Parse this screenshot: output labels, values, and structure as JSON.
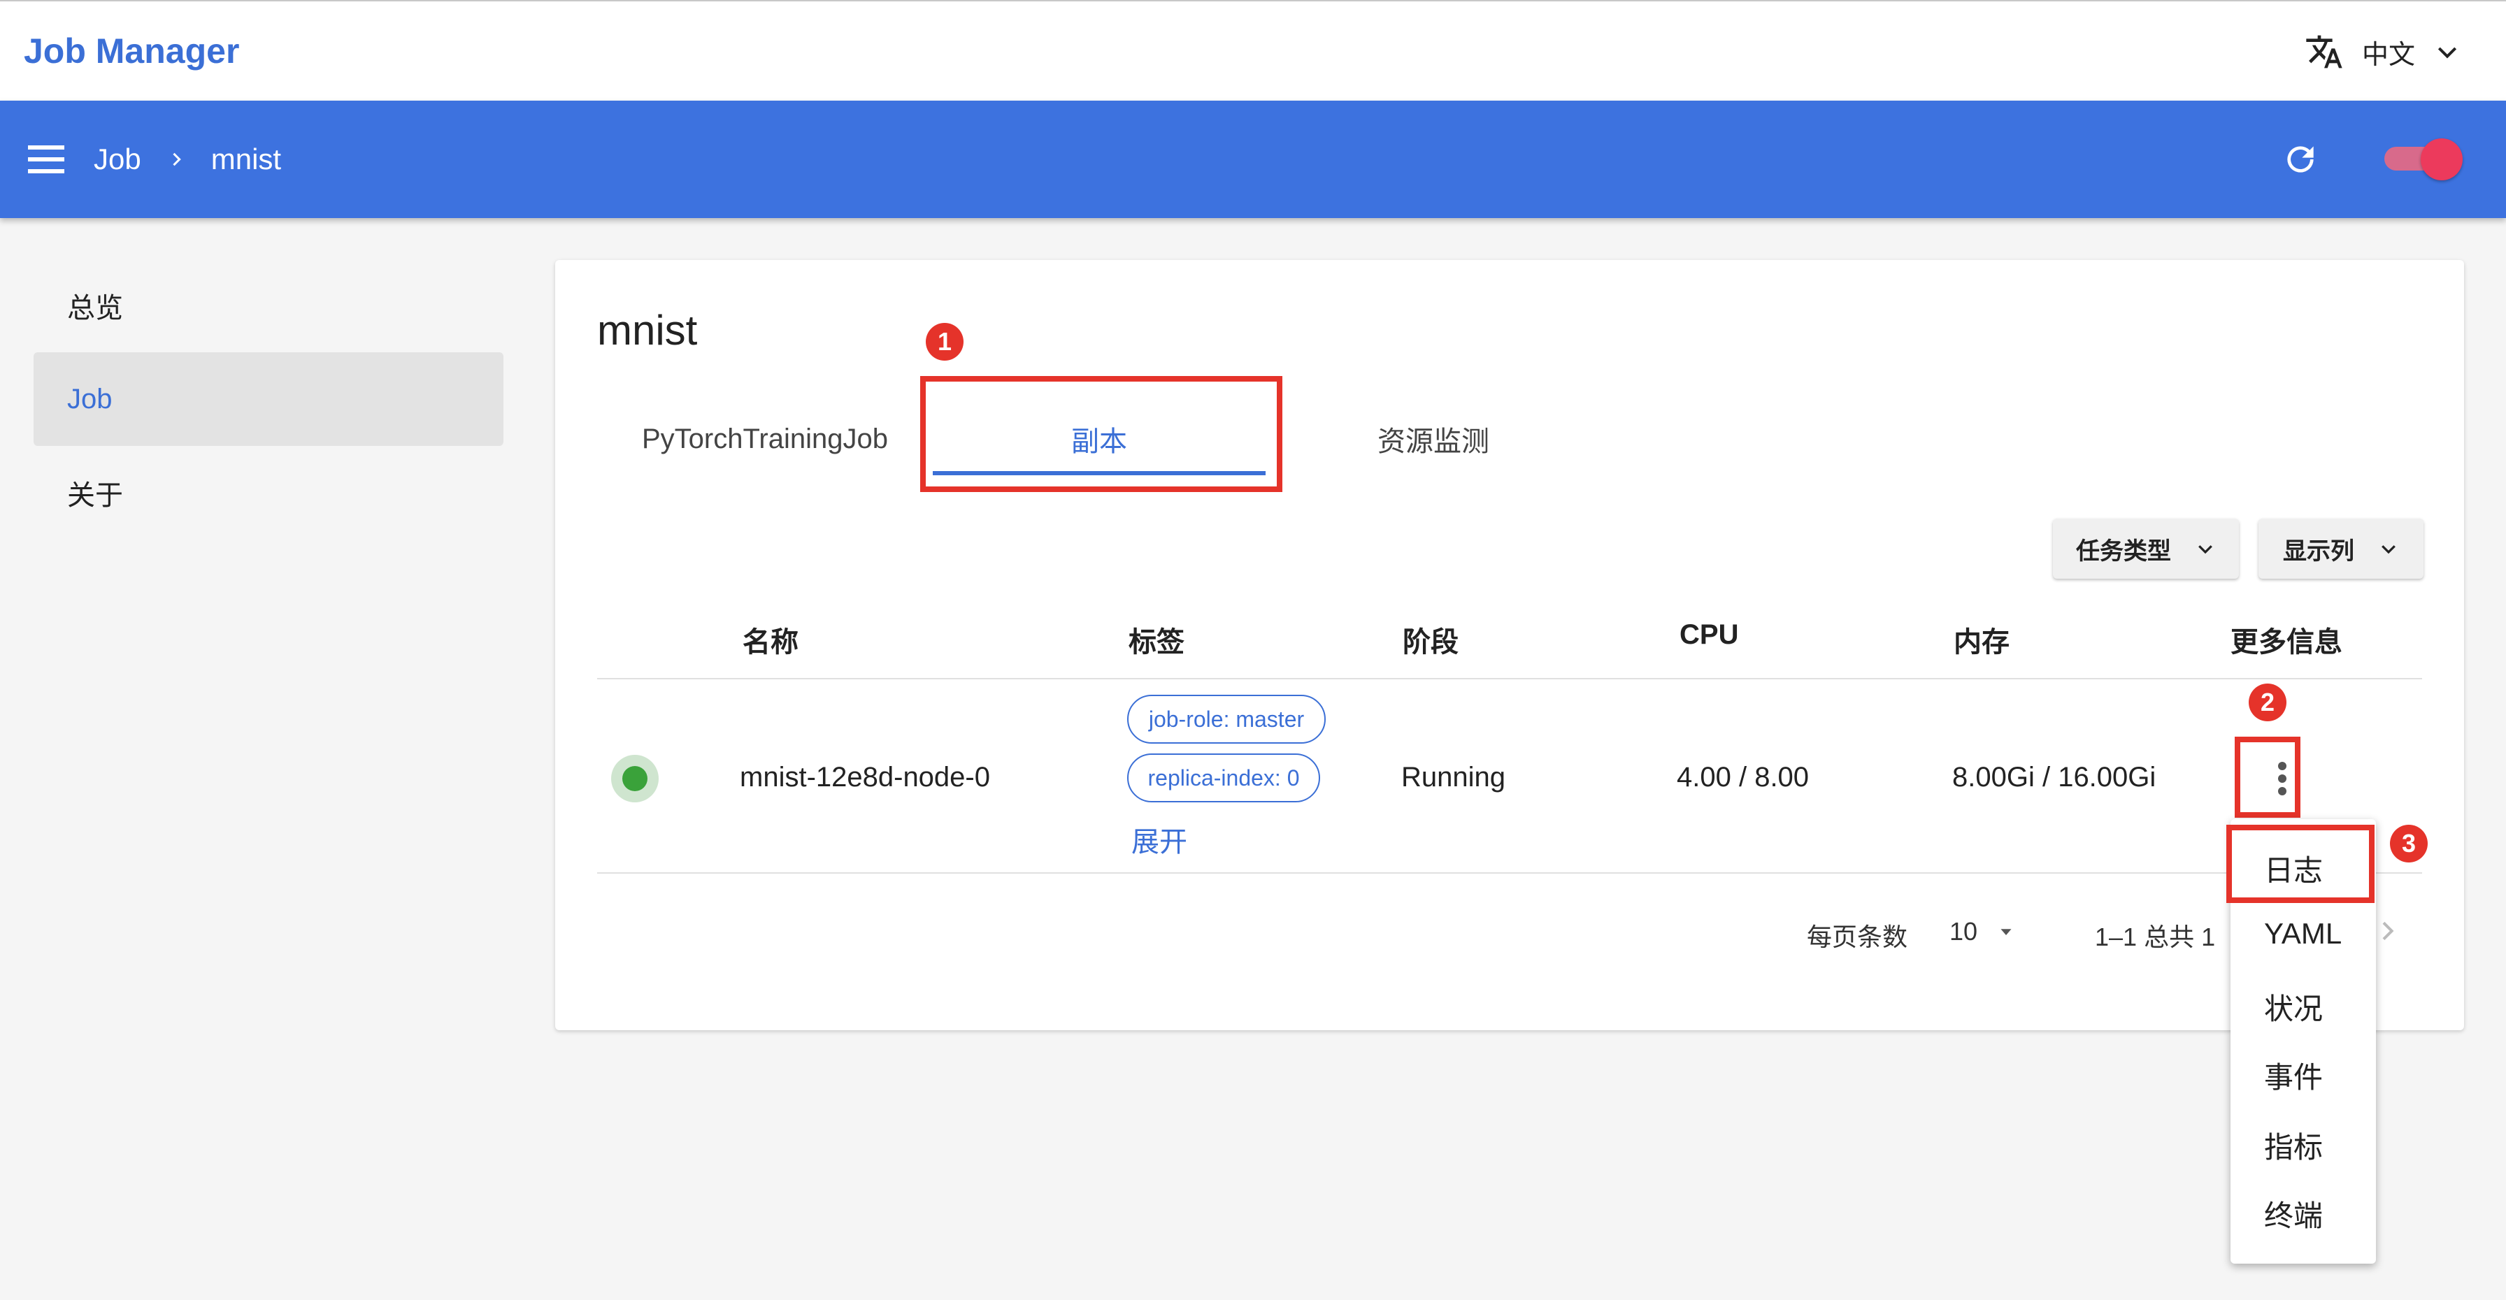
{
  "header": {
    "app_title": "Job Manager",
    "language": "中文",
    "translate_icon": "translate-icon",
    "lang_chevron_icon": "chevron-down-icon"
  },
  "appbar": {
    "menu_icon": "menu-icon",
    "breadcrumb": [
      "Job",
      "mnist"
    ],
    "breadcrumb_separator_icon": "chevron-right-icon",
    "refresh_icon": "refresh-icon",
    "toggle_on": true,
    "colors": {
      "bar": "#3d72df",
      "toggle": "#ec3a5c"
    }
  },
  "sidebar": {
    "items": [
      {
        "label": "总览",
        "active": false
      },
      {
        "label": "Job",
        "active": true
      },
      {
        "label": "关于",
        "active": false
      }
    ]
  },
  "card": {
    "title": "mnist",
    "tabs": [
      {
        "label": "PyTorchTrainingJob",
        "active": false
      },
      {
        "label": "副本",
        "active": true
      },
      {
        "label": "资源监测",
        "active": false
      }
    ],
    "filters": {
      "task_type_label": "任务类型",
      "columns_label": "显示列"
    },
    "table": {
      "headers": [
        "名称",
        "标签",
        "阶段",
        "CPU",
        "内存",
        "更多信息"
      ],
      "rows": [
        {
          "status": "running",
          "name": "mnist-12e8d-node-0",
          "labels": [
            "job-role: master",
            "replica-index: 0"
          ],
          "expand_label": "展开",
          "phase": "Running",
          "cpu": "4.00 / 8.00",
          "memory": "8.00Gi / 16.00Gi",
          "more_icon": "more-vert-icon"
        }
      ]
    },
    "pagination": {
      "rows_per_page_label": "每页条数",
      "rows_per_page": "10",
      "range": "1–1 总共 1"
    }
  },
  "context_menu": {
    "items": [
      "日志",
      "YAML",
      "状况",
      "事件",
      "指标",
      "终端"
    ]
  },
  "annotations": {
    "markers": [
      "1",
      "2",
      "3"
    ],
    "color": "#e5332a"
  }
}
